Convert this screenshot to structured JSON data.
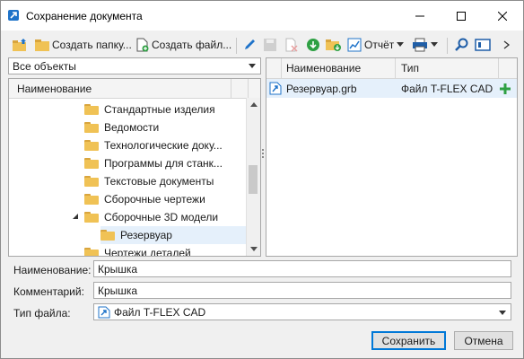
{
  "window": {
    "title": "Сохранение документа",
    "minimize": "—",
    "maximize": "☐",
    "close": "✕"
  },
  "toolbar": {
    "create_folder": "Создать папку...",
    "create_file": "Создать файл...",
    "report": "Отчёт"
  },
  "left": {
    "filter": "Все объекты",
    "column": "Наименование",
    "items": [
      "Стандартные изделия",
      "Ведомости",
      "Технологические доку...",
      "Программы для станк...",
      "Текстовые документы",
      "Сборочные чертежи",
      "Сборочные 3D модели",
      "Резервуар",
      "Чертежи деталей"
    ]
  },
  "right": {
    "col_name": "Наименование",
    "col_type": "Тип",
    "rows": [
      {
        "name": "Резервуар.grb",
        "type": "Файл T-FLEX CAD"
      }
    ]
  },
  "form": {
    "name_label": "Наименование:",
    "name_value": "Крышка",
    "comment_label": "Комментарий:",
    "comment_value": "Крышка",
    "filetype_label": "Тип файла:",
    "filetype_value": "Файл T-FLEX CAD"
  },
  "buttons": {
    "save": "Сохранить",
    "cancel": "Отмена"
  },
  "colors": {
    "accent": "#0078d7",
    "folder": "#f0c255",
    "selection": "#e5f0fb",
    "add": "#2ea043"
  }
}
